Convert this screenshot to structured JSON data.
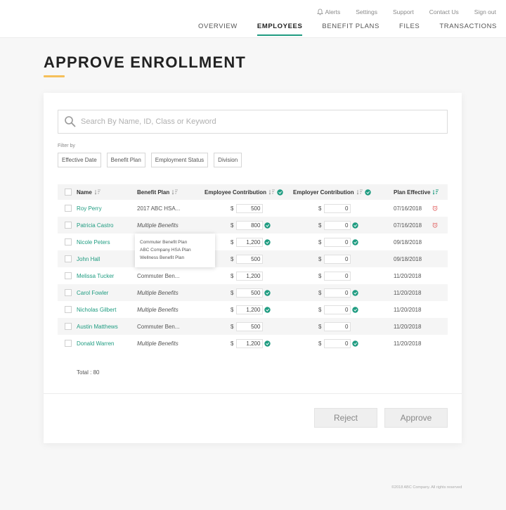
{
  "colors": {
    "accent": "#1f9c81",
    "title_underline": "#f5c05a",
    "alarm": "#e05b5b"
  },
  "utility_nav": {
    "alerts": "Alerts",
    "settings": "Settings",
    "support": "Support",
    "contact": "Contact Us",
    "signout": "Sign out"
  },
  "main_nav": {
    "overview": "OVERVIEW",
    "employees": "EMPLOYEES",
    "benefit_plans": "BENEFIT PLANS",
    "files": "FILES",
    "transactions": "TRANSACTIONS"
  },
  "page_title": "APPROVE ENROLLMENT",
  "search": {
    "placeholder": "Search By Name, ID, Class or Keyword"
  },
  "filter": {
    "label": "Filter by",
    "chips": [
      "Effective Date",
      "Benefit Plan",
      "Employment Status",
      "Division"
    ]
  },
  "table": {
    "headers": {
      "name": "Name",
      "plan": "Benefit Plan",
      "employee": "Employee Contribution",
      "employer": "Employer Contribution",
      "effective": "Plan Effective"
    },
    "currency": "$",
    "rows": [
      {
        "name": "Roy Perry",
        "plan": "2017 ABC HSA...",
        "emp": "500",
        "er": "0",
        "date": "07/16/2018"
      },
      {
        "name": "Patricia Castro",
        "plan": "Multiple Benefits",
        "emp": "800",
        "er": "0",
        "date": "07/16/2018"
      },
      {
        "name": "Nicole Peters",
        "plan": "",
        "emp": "1,200",
        "er": "0",
        "date": "09/18/2018"
      },
      {
        "name": "John Hall",
        "plan": "",
        "emp": "500",
        "er": "0",
        "date": "09/18/2018"
      },
      {
        "name": "Melissa Tucker",
        "plan": "Commuter Ben...",
        "emp": "1,200",
        "er": "0",
        "date": "11/20/2018"
      },
      {
        "name": "Carol Fowler",
        "plan": "Multiple Benefits",
        "emp": "500",
        "er": "0",
        "date": "11/20/2018"
      },
      {
        "name": "Nicholas Gilbert",
        "plan": "Multiple Benefits",
        "emp": "1,200",
        "er": "0",
        "date": "11/20/2018"
      },
      {
        "name": "Austin Matthews",
        "plan": "Commuter Ben...",
        "emp": "500",
        "er": "0",
        "date": "11/20/2018"
      },
      {
        "name": "Donald Warren",
        "plan": "Multiple Benefits",
        "emp": "1,200",
        "er": "0",
        "date": "11/20/2018"
      }
    ]
  },
  "popover": {
    "items": [
      "Commuter Benefit Plan",
      "ABC Company HSA Plan",
      "Wellness Benefit Plan"
    ]
  },
  "total": "Total : 80",
  "buttons": {
    "reject": "Reject",
    "approve": "Approve"
  },
  "footer": "©2018 ABC Company. All rights reserved"
}
